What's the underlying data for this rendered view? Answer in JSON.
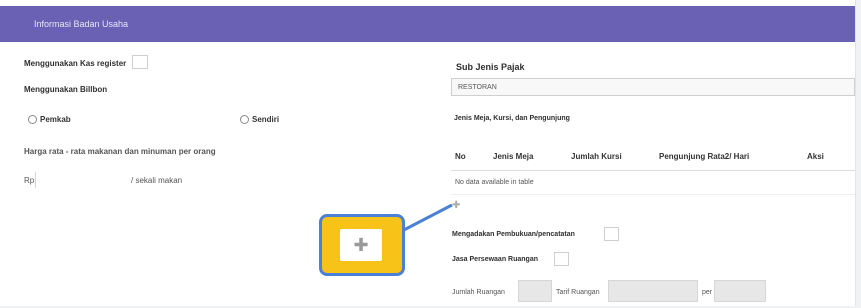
{
  "header": {
    "title": "Informasi Badan Usaha"
  },
  "left": {
    "kas_register_label": "Menggunakan Kas register",
    "bill_label": "Menggunakan Billbon",
    "radio_pemkab": "Pemkab",
    "radio_sendiri": "Sendiri",
    "harga_label": "Harga rata - rata makanan dan minuman per orang",
    "currency_prefix": "Rp",
    "per_unit": "/ sekali makan"
  },
  "right": {
    "sub_jenis_label": "Sub Jenis Pajak",
    "sub_jenis_value": "RESTORAN",
    "jenis_meja_label": "Jenis Meja, Kursi, dan Pengunjung",
    "table": {
      "columns": [
        "No",
        "Jenis Meja",
        "Jumlah Kursi",
        "Pengunjung Rata2/ Hari",
        "Aksi"
      ],
      "empty_text": "No data available in table"
    },
    "pembukuan_label": "Mengadakan Pembukuan/pencatatan",
    "sewa_label": "Jasa Persewaan Ruangan",
    "jumlah_ruangan_label": "Jumlah Ruangan",
    "tarif_ruangan_label": "Tarif Ruangan",
    "per_label": "per"
  },
  "callout": {
    "icon": "plus-icon",
    "border_color": "#4a80d6",
    "fill_color": "#f7c318"
  },
  "colors": {
    "header": "#6b61b4"
  }
}
